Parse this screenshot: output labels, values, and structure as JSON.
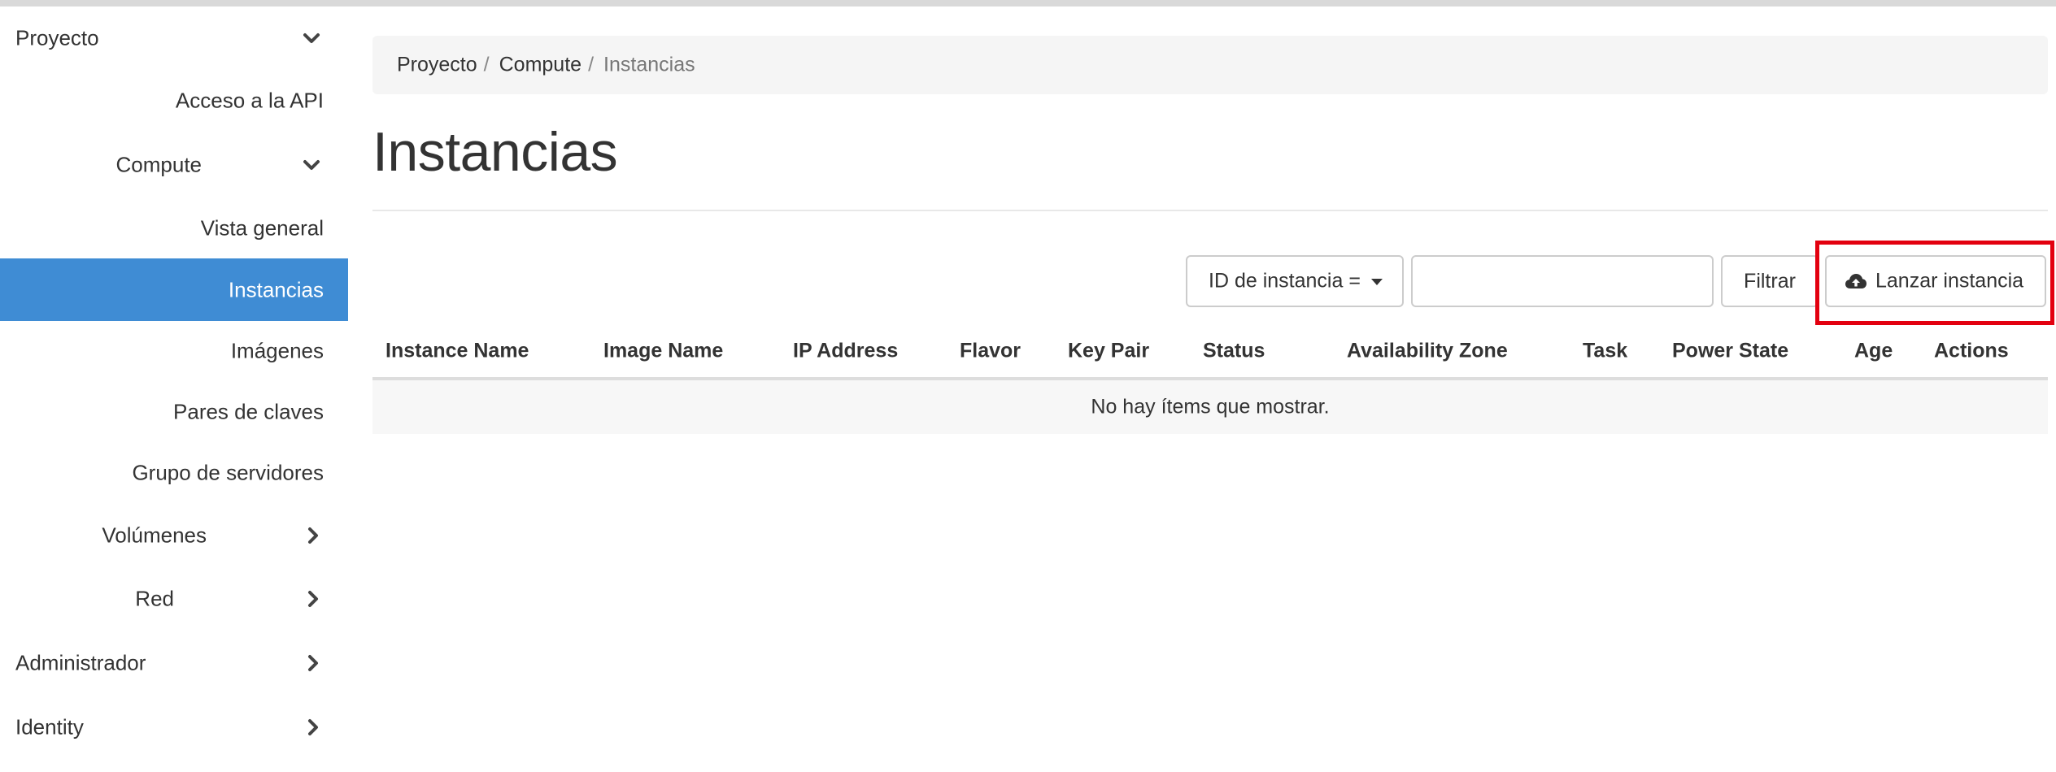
{
  "sidebar": {
    "proyecto": "Proyecto",
    "acceso_api": "Acceso a la API",
    "compute": "Compute",
    "vista_general": "Vista general",
    "instancias": "Instancias",
    "imagenes": "Imágenes",
    "pares_claves": "Pares de claves",
    "grupo_servidores": "Grupo de servidores",
    "volumenes": "Volúmenes",
    "red": "Red",
    "administrador": "Administrador",
    "identity": "Identity",
    "active_color": "#3f8cd4"
  },
  "breadcrumb": {
    "items": [
      "Proyecto",
      "Compute",
      "Instancias"
    ],
    "separator": "/"
  },
  "page": {
    "title": "Instancias"
  },
  "toolbar": {
    "filter_select": "ID de instancia =",
    "filter_input_value": "",
    "filter_button": "Filtrar",
    "launch_button": "Lanzar instancia",
    "launch_icon": "cloud-upload-icon",
    "highlight_color": "#e3000f"
  },
  "table": {
    "columns": [
      "Instance Name",
      "Image Name",
      "IP Address",
      "Flavor",
      "Key Pair",
      "Status",
      "Availability Zone",
      "Task",
      "Power State",
      "Age",
      "Actions"
    ],
    "empty_message": "No hay ítems que mostrar."
  }
}
